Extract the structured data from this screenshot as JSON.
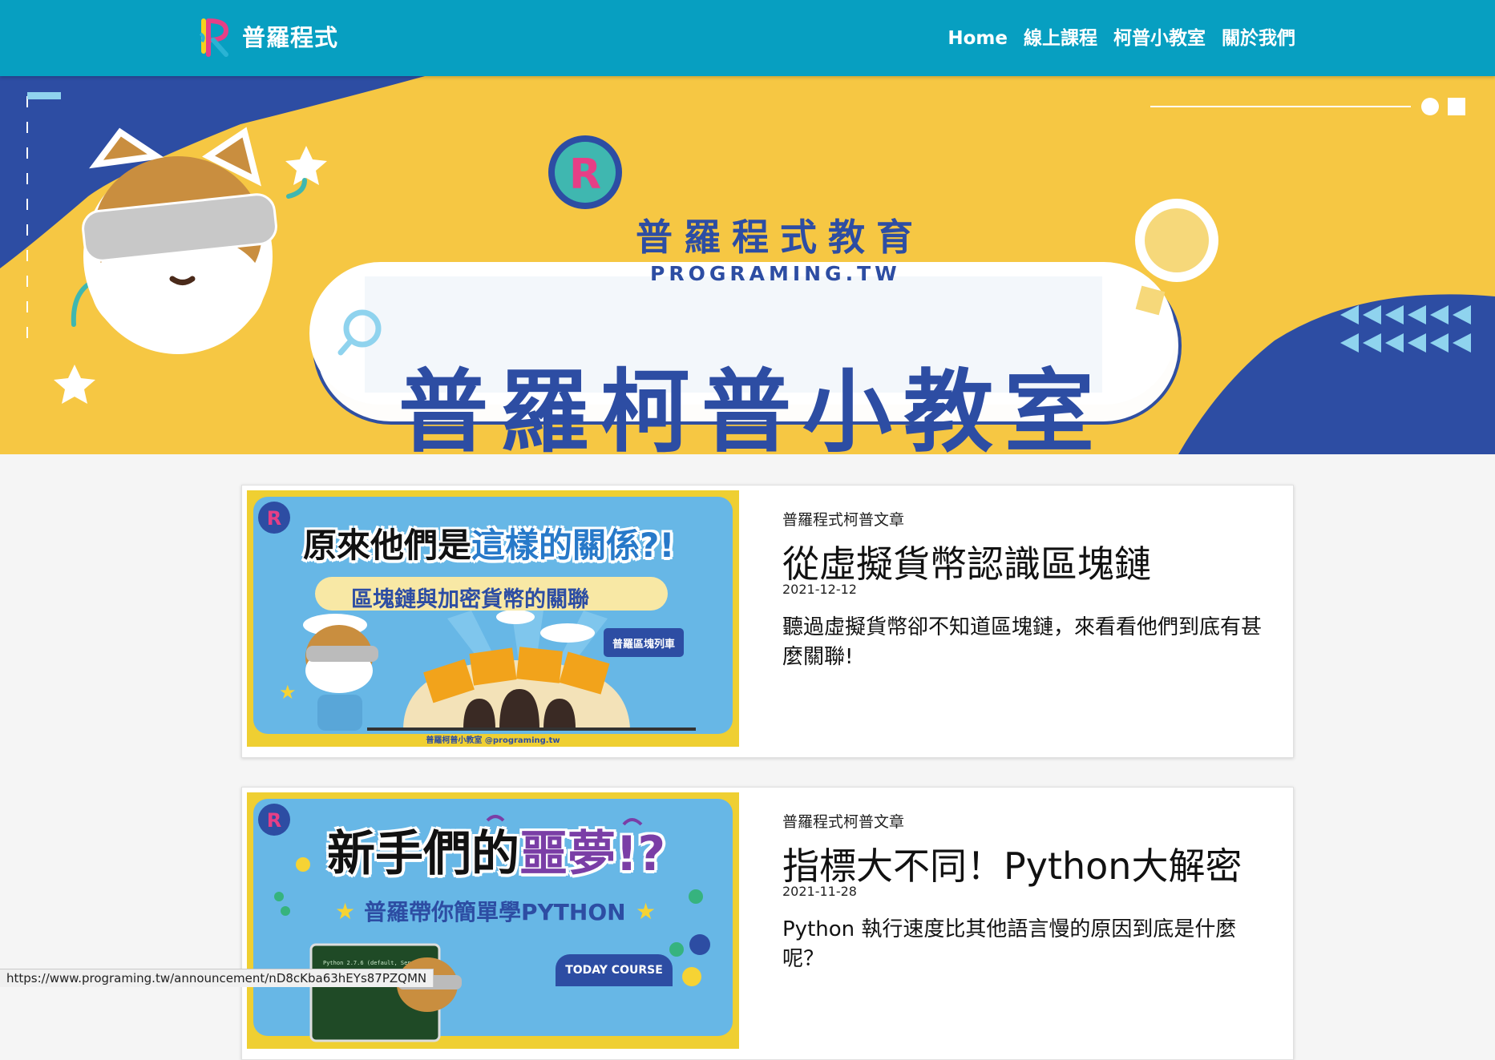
{
  "navbar": {
    "brand": "普羅程式",
    "links": [
      "Home",
      "線上課程",
      "柯普小教室",
      "關於我們"
    ]
  },
  "hero": {
    "brand_cn": "普羅程式教育",
    "brand_en": "PROGRAMING.TW",
    "title": "普羅柯普小教室"
  },
  "articles": [
    {
      "category": "普羅程式柯普文章",
      "title": "從虛擬貨幣認識區塊鏈",
      "date": "2021-12-12",
      "description": "聽過虛擬貨幣卻不知道區塊鏈，來看看他們到底有甚麼關聯!",
      "thumb": {
        "heading_a": "原來他們是",
        "heading_b": "這樣的關係?!",
        "subtitle": "區塊鏈與加密貨幣的關聯",
        "badge": "普羅區塊列車",
        "footer": "普羅柯普小教室 @programing.tw"
      }
    },
    {
      "category": "普羅程式柯普文章",
      "title": "指標大不同！Python大解密",
      "date": "2021-11-28",
      "description": "Python 執行速度比其他語言慢的原因到底是什麼呢？",
      "thumb": {
        "heading_a": "新手們的",
        "heading_b": "噩夢!?",
        "subtitle": "普羅帶你簡單學PYTHON",
        "badge": "TODAY COURSE"
      }
    }
  ],
  "status_url": "https://www.programing.tw/announcement/nD8cKba63hEYs87PZQMN",
  "colors": {
    "navbar": "#079fc1",
    "hero_yellow": "#f6c743",
    "hero_blue": "#2d4da3",
    "thumb_blue": "#67b7e6"
  }
}
